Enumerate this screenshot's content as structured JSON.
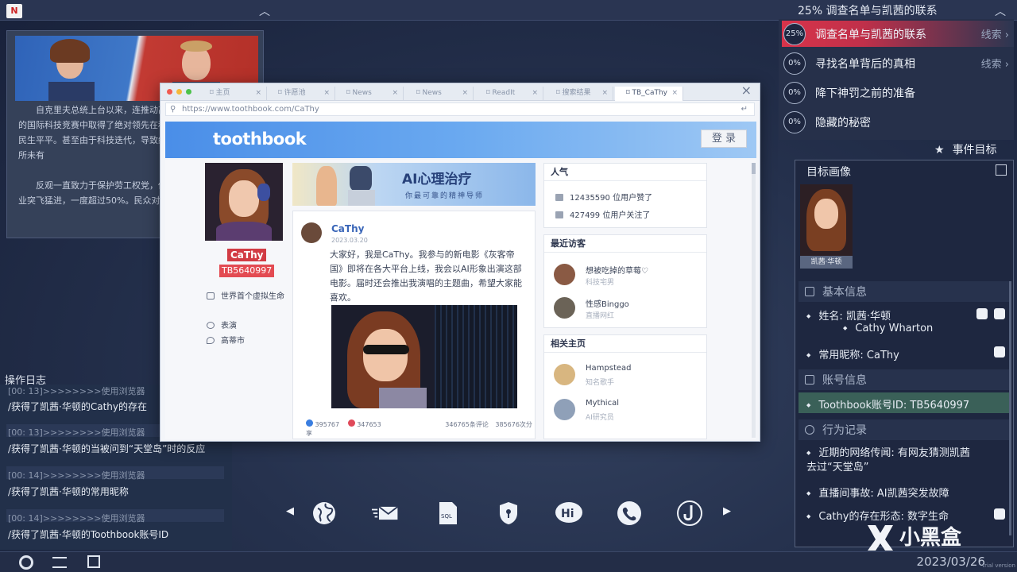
{
  "top": {
    "objective_header": "25%   调查名单与凯茜的联系"
  },
  "objectives": [
    {
      "pct": "25%",
      "text": "调查名单与凯茜的联系",
      "clue": "线索 ›",
      "active": true
    },
    {
      "pct": "0%",
      "text": "寻找名单背后的真相",
      "clue": "线索 ›",
      "active": false
    },
    {
      "pct": "0%",
      "text": "降下神罚之前的准备",
      "clue": "",
      "active": false
    },
    {
      "pct": "0%",
      "text": "隐藏的秘密",
      "clue": "",
      "active": false
    }
  ],
  "events_label": "事件目标",
  "article": {
    "paragraph1": "自克里夫总统上台以来，连推动高新产业与人工智能技术的国际科技竞赛中取得了绝对领先在科技领域成绩斐然，但在民生平平。甚至由于科技迭代，导致给寻求连任的她带来了前所未有",
    "paragraph2": "反观一直致力于保护劳工权党，他们得到了工会与传统行业突飞猛进，一度超过50%。民众对"
  },
  "log": {
    "title": "操作日志",
    "entries": [
      {
        "time": "[00: 13]>>>>>>>>使用浏览器",
        "text": "/获得了凯茜·华顿的Cathy的存在"
      },
      {
        "time": "[00: 13]>>>>>>>>使用浏览器",
        "text": "/获得了凯茜·华顿的当被问到“天堂岛”时的反应"
      },
      {
        "time": "[00: 14]>>>>>>>>使用浏览器",
        "text": "/获得了凯茜·华顿的常用昵称"
      },
      {
        "time": "[00: 14]>>>>>>>>使用浏览器",
        "text": "/获得了凯茜·华顿的Toothbook账号ID"
      }
    ]
  },
  "browser": {
    "tabs": [
      "主页",
      "许愿池",
      "News",
      "News",
      "ReadIt",
      "搜索结果",
      "TB_CaThy"
    ],
    "url": "https://www.toothbook.com/CaThy",
    "site_logo": "toothbook",
    "login_label": "登 录",
    "profile": {
      "name": "CaThy",
      "id": "TB5640997",
      "meta": [
        "世界首个虚拟生命",
        "表演",
        "高蒂市"
      ]
    },
    "banner": {
      "title": "AI心理治疗",
      "subtitle": "你最可靠的精神导师"
    },
    "post": {
      "author": "CaThy",
      "date": "2023.03.20",
      "text": "大家好，我是CaThy。我参与的新电影《灰客帝国》即将在各大平台上线，我会以AI形象出演这部电影。届时还会推出我演唱的主题曲，希望大家能喜欢。",
      "likes": "395767",
      "hearts": "347653",
      "comments": "346765条评论",
      "shares": "385676次分享"
    },
    "popularity": {
      "title": "人气",
      "likes": "12435590  位用户赞了",
      "follows": "427499  位用户关注了"
    },
    "visitors": {
      "title": "最近访客",
      "items": [
        {
          "name": "想被吃掉的草莓♡",
          "sub": "科技宅男"
        },
        {
          "name": "性感Binggo",
          "sub": "直播网红"
        }
      ]
    },
    "related": {
      "title": "相关主页",
      "items": [
        {
          "name": "Hampstead",
          "sub": "知名歌手"
        },
        {
          "name": "Mythical",
          "sub": "AI研究员"
        }
      ]
    }
  },
  "profile_panel": {
    "title": "目标画像",
    "thumb_caption": "凯茜·华顿",
    "basic_title": "基本信息",
    "name_label": "姓名:  凯茜·华顿",
    "name_en": "Cathy Wharton",
    "nickname": "常用昵称: CaThy",
    "account_title": "账号信息",
    "account_id": "Toothbook账号ID: TB5640997",
    "behavior_title": "行为记录",
    "behaviors": [
      "近期的网络传闻: 有网友猜测凯茜去过“天堂岛”",
      "直播间事故: AI凯茜突发故障",
      "Cathy的存在形态: 数字生命"
    ]
  },
  "bottom": {
    "date": "2023/03/26",
    "trial": "trial version"
  },
  "colors": {
    "accent": "#d8334a",
    "highlight": "#3a6058",
    "link": "#3a66b8"
  }
}
